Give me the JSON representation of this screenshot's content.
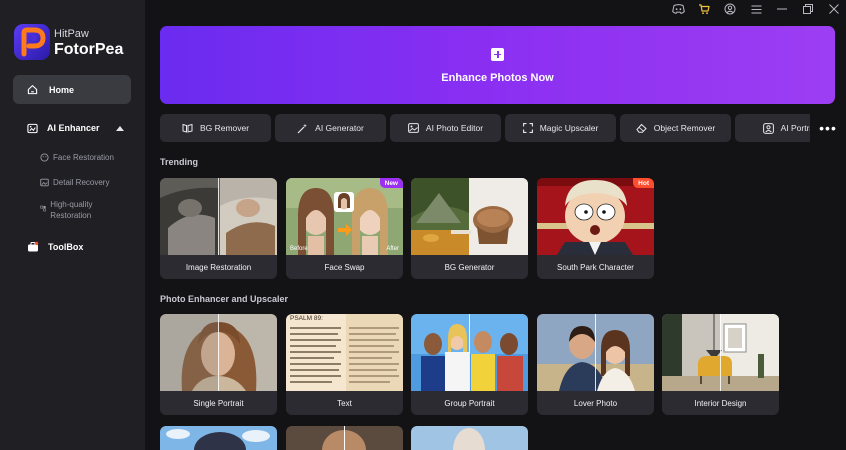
{
  "app": {
    "brand_small": "HitPaw",
    "brand_name": "FotorPea"
  },
  "sidebar": {
    "home": "Home",
    "ai_enhancer": "AI Enhancer",
    "sub_items": [
      "Face Restoration",
      "Detail Recovery",
      "High-quality Restoration"
    ],
    "toolbox": "ToolBox"
  },
  "hero": {
    "label": "Enhance Photos Now"
  },
  "tools": [
    "BG Remover",
    "AI Generator",
    "AI Photo Editor",
    "Magic Upscaler",
    "Object Remover",
    "AI Portrait"
  ],
  "trending": {
    "title": "Trending",
    "cards": [
      {
        "label": "Image Restoration"
      },
      {
        "label": "Face Swap",
        "badge": "New",
        "before": "Before",
        "after": "After"
      },
      {
        "label": "BG Generator"
      },
      {
        "label": "South Park Character",
        "badge": "Hot"
      }
    ]
  },
  "enhancer": {
    "title": "Photo Enhancer and Upscaler",
    "cards": [
      {
        "label": "Single Portrait"
      },
      {
        "label": "Text",
        "psalm": "PSALM 89:"
      },
      {
        "label": "Group Portrait"
      },
      {
        "label": "Lover Photo"
      },
      {
        "label": "Interior Design"
      }
    ]
  },
  "colors": {
    "accent": "#8b2ff2",
    "new_badge": "#9b2ff2",
    "hot_badge": "#ff4d2e",
    "sidebar_bg": "#1f1f24",
    "page_bg": "#131316"
  }
}
